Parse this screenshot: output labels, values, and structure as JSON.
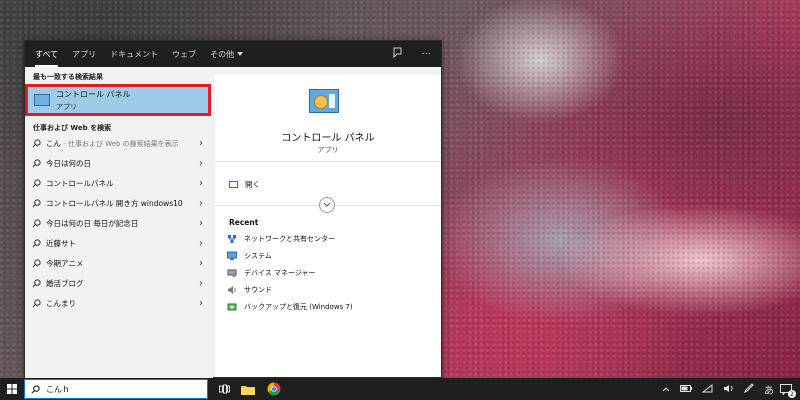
{
  "tabs": [
    {
      "label": "すべて"
    },
    {
      "label": "アプリ"
    },
    {
      "label": "ドキュメント"
    },
    {
      "label": "ウェブ"
    },
    {
      "label": "その他"
    }
  ],
  "best_match": {
    "section_label": "最も一致する検索結果",
    "title": "コントロール パネル",
    "subtitle": "アプリ"
  },
  "web_section_label": "仕事および Web を検索",
  "web_results": [
    {
      "label": "こん",
      "hint": " - 仕事および Web の検索結果を表示"
    },
    {
      "label": "今日は何の日",
      "hint": ""
    },
    {
      "label": "コントロールパネル",
      "hint": ""
    },
    {
      "label": "コントロールパネル 開き方 windows10",
      "hint": ""
    },
    {
      "label": "今日は何の日 毎日が記念日",
      "hint": ""
    },
    {
      "label": "近藤サト",
      "hint": ""
    },
    {
      "label": "今期アニメ",
      "hint": ""
    },
    {
      "label": "婚活ブログ",
      "hint": ""
    },
    {
      "label": "こんまり",
      "hint": ""
    }
  ],
  "detail": {
    "title": "コントロール パネル",
    "subtitle": "アプリ",
    "open_label": "開く",
    "recent_label": "Recent",
    "recent_items": [
      {
        "label": "ネットワークと共有センター",
        "icon": "network-icon"
      },
      {
        "label": "システム",
        "icon": "system-icon"
      },
      {
        "label": "デバイス マネージャー",
        "icon": "device-manager-icon"
      },
      {
        "label": "サウンド",
        "icon": "sound-icon"
      },
      {
        "label": "バックアップと復元 (Windows 7)",
        "icon": "backup-icon"
      }
    ]
  },
  "taskbar": {
    "search_value": "こんｈ",
    "ime_label": "あ",
    "notification_count": "2"
  },
  "colors": {
    "highlight": "#9fcbe8",
    "annotation_border": "#e11b22",
    "accent": "#0078d7"
  }
}
